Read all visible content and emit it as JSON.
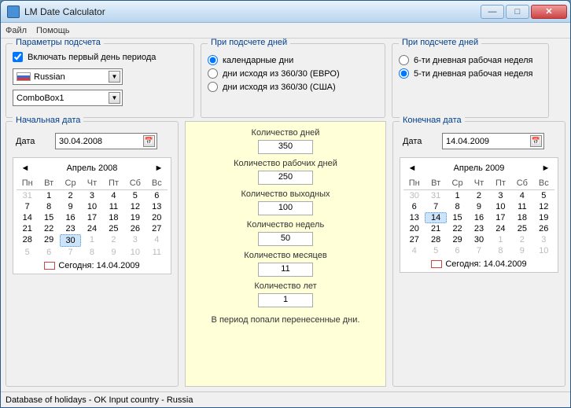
{
  "window": {
    "title": "LM Date Calculator"
  },
  "menu": {
    "file": "Файл",
    "help": "Помощь"
  },
  "params": {
    "legend": "Параметры подсчета",
    "include_first_day": "Включать первый день периода",
    "include_first_day_checked": true,
    "language": "Russian",
    "combobox1": "ComboBox1"
  },
  "days_mode": {
    "legend": "При подсчете дней",
    "calendar": "календарные дни",
    "euro": "дни исходя из 360/30 (ЕВРО)",
    "usa": "дни исходя из 360/30 (США)",
    "selected": "calendar"
  },
  "week_type": {
    "legend": "При подсчете дней",
    "six": "6-ти дневная рабочая неделя",
    "five": "5-ти дневная рабочая неделя",
    "selected": "five"
  },
  "start_date": {
    "legend": "Начальная дата",
    "label": "Дата",
    "value": "30.04.2008",
    "cal_title": "Апрель 2008",
    "today_label": "Сегодня: 14.04.2009"
  },
  "end_date": {
    "legend": "Конечная дата",
    "label": "Дата",
    "value": "14.04.2009",
    "cal_title": "Апрель 2009",
    "today_label": "Сегодня: 14.04.2009"
  },
  "dow": [
    "Пн",
    "Вт",
    "Ср",
    "Чт",
    "Пт",
    "Сб",
    "Вс"
  ],
  "results": {
    "days_label": "Количество дней",
    "days": "350",
    "work_days_label": "Количество рабочих дней",
    "work_days": "250",
    "weekend_days_label": "Количество выходных",
    "weekend_days": "100",
    "weeks_label": "Количество недель",
    "weeks": "50",
    "months_label": "Количество месяцев",
    "months": "11",
    "years_label": "Количество лет",
    "years": "1",
    "note": "В период попали перенесенные дни."
  },
  "status": "Database of holidays - OK Input country - Russia",
  "start_cal_days": [
    {
      "d": "31",
      "o": true
    },
    {
      "d": "1"
    },
    {
      "d": "2"
    },
    {
      "d": "3"
    },
    {
      "d": "4"
    },
    {
      "d": "5"
    },
    {
      "d": "6"
    },
    {
      "d": "7"
    },
    {
      "d": "8"
    },
    {
      "d": "9"
    },
    {
      "d": "10"
    },
    {
      "d": "11"
    },
    {
      "d": "12"
    },
    {
      "d": "13"
    },
    {
      "d": "14"
    },
    {
      "d": "15"
    },
    {
      "d": "16"
    },
    {
      "d": "17"
    },
    {
      "d": "18"
    },
    {
      "d": "19"
    },
    {
      "d": "20"
    },
    {
      "d": "21"
    },
    {
      "d": "22"
    },
    {
      "d": "23"
    },
    {
      "d": "24"
    },
    {
      "d": "25"
    },
    {
      "d": "26"
    },
    {
      "d": "27"
    },
    {
      "d": "28"
    },
    {
      "d": "29"
    },
    {
      "d": "30",
      "sel": true
    },
    {
      "d": "1",
      "o": true
    },
    {
      "d": "2",
      "o": true
    },
    {
      "d": "3",
      "o": true
    },
    {
      "d": "4",
      "o": true
    },
    {
      "d": "5",
      "o": true
    },
    {
      "d": "6",
      "o": true
    },
    {
      "d": "7",
      "o": true
    },
    {
      "d": "8",
      "o": true
    },
    {
      "d": "9",
      "o": true
    },
    {
      "d": "10",
      "o": true
    },
    {
      "d": "11",
      "o": true
    }
  ],
  "end_cal_days": [
    {
      "d": "30",
      "o": true
    },
    {
      "d": "31",
      "o": true
    },
    {
      "d": "1"
    },
    {
      "d": "2"
    },
    {
      "d": "3"
    },
    {
      "d": "4"
    },
    {
      "d": "5"
    },
    {
      "d": "6"
    },
    {
      "d": "7"
    },
    {
      "d": "8"
    },
    {
      "d": "9"
    },
    {
      "d": "10"
    },
    {
      "d": "11"
    },
    {
      "d": "12"
    },
    {
      "d": "13"
    },
    {
      "d": "14",
      "sel": true,
      "today": true
    },
    {
      "d": "15"
    },
    {
      "d": "16"
    },
    {
      "d": "17"
    },
    {
      "d": "18"
    },
    {
      "d": "19"
    },
    {
      "d": "20"
    },
    {
      "d": "21"
    },
    {
      "d": "22"
    },
    {
      "d": "23"
    },
    {
      "d": "24"
    },
    {
      "d": "25"
    },
    {
      "d": "26"
    },
    {
      "d": "27"
    },
    {
      "d": "28"
    },
    {
      "d": "29"
    },
    {
      "d": "30"
    },
    {
      "d": "1",
      "o": true
    },
    {
      "d": "2",
      "o": true
    },
    {
      "d": "3",
      "o": true
    },
    {
      "d": "4",
      "o": true
    },
    {
      "d": "5",
      "o": true
    },
    {
      "d": "6",
      "o": true
    },
    {
      "d": "7",
      "o": true
    },
    {
      "d": "8",
      "o": true
    },
    {
      "d": "9",
      "o": true
    },
    {
      "d": "10",
      "o": true
    }
  ]
}
